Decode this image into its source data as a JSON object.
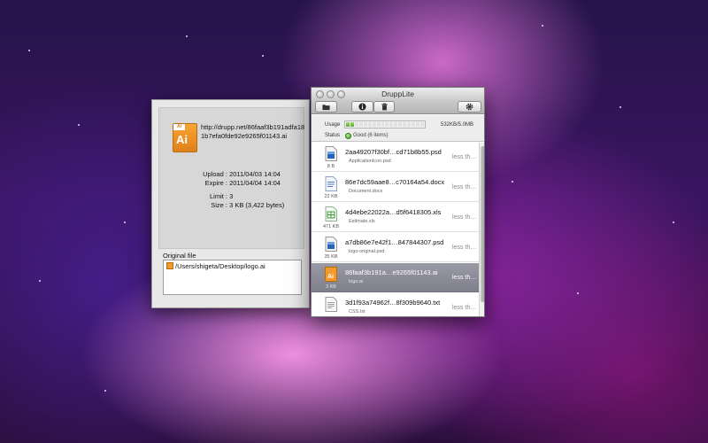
{
  "window": {
    "title": "DruppLite",
    "toolbar": {
      "open_icon": "folder-icon",
      "info_icon": "info-icon",
      "delete_icon": "trash-icon",
      "settings_icon": "gear-icon"
    },
    "usage": {
      "label": "Usage",
      "text": "532KB/5.0MB",
      "segments_filled": 2,
      "segments_total": 18,
      "color": "#58a92e"
    },
    "status": {
      "label": "Status",
      "text": "Good (6 items)"
    }
  },
  "files": [
    {
      "name": "2aa49207f30bf…cd71b8b55.psd",
      "sub": "ApplicationIcon.psd",
      "size": "8 B",
      "expire": "less th…",
      "icon": "psd-file-icon",
      "selected": false
    },
    {
      "name": "86e7dc59aae8…c70164a54.docx",
      "sub": "Document.docx",
      "size": "22 KB",
      "expire": "less th…",
      "icon": "docx-file-icon",
      "selected": false
    },
    {
      "name": "4d4ebe22022a…d5f6418305.xls",
      "sub": "Estimate.xls",
      "size": "471 KB",
      "expire": "less th…",
      "icon": "xls-file-icon",
      "selected": false
    },
    {
      "name": "a7db86e7e42f1…847844307.psd",
      "sub": "logo-original.psd",
      "size": "35 KB",
      "expire": "less th…",
      "icon": "psd-file-icon",
      "selected": false
    },
    {
      "name": "86faaf3b191a…e9265f01143.ai",
      "sub": "logo.ai",
      "size": "3 KB",
      "expire": "less th…",
      "icon": "ai-file-icon",
      "selected": true
    },
    {
      "name": "3d1f93a74962f…8f309b9640.txt",
      "sub": "CSS.txt",
      "size": "",
      "expire": "less th…",
      "icon": "txt-file-icon",
      "selected": false
    }
  ],
  "info_panel": {
    "url": "http://drupp.net/86faaf3b191adfa181b7efa0fde92e9265f01143.ai",
    "upload_label": "Upload :",
    "upload_value": "2011/04/03 14:04",
    "expire_label": "Expire :",
    "expire_value": "2011/04/04 14:04",
    "limit_label": "Limit :",
    "limit_value": "3",
    "size_label": "Size :",
    "size_value": "3 KB  (3,422 bytes)",
    "original_file_label": "Original file",
    "original_file_path": "/Users/shigeta/Desktop/logo.ai",
    "icon_tag": "AI",
    "icon_text": "Ai"
  }
}
